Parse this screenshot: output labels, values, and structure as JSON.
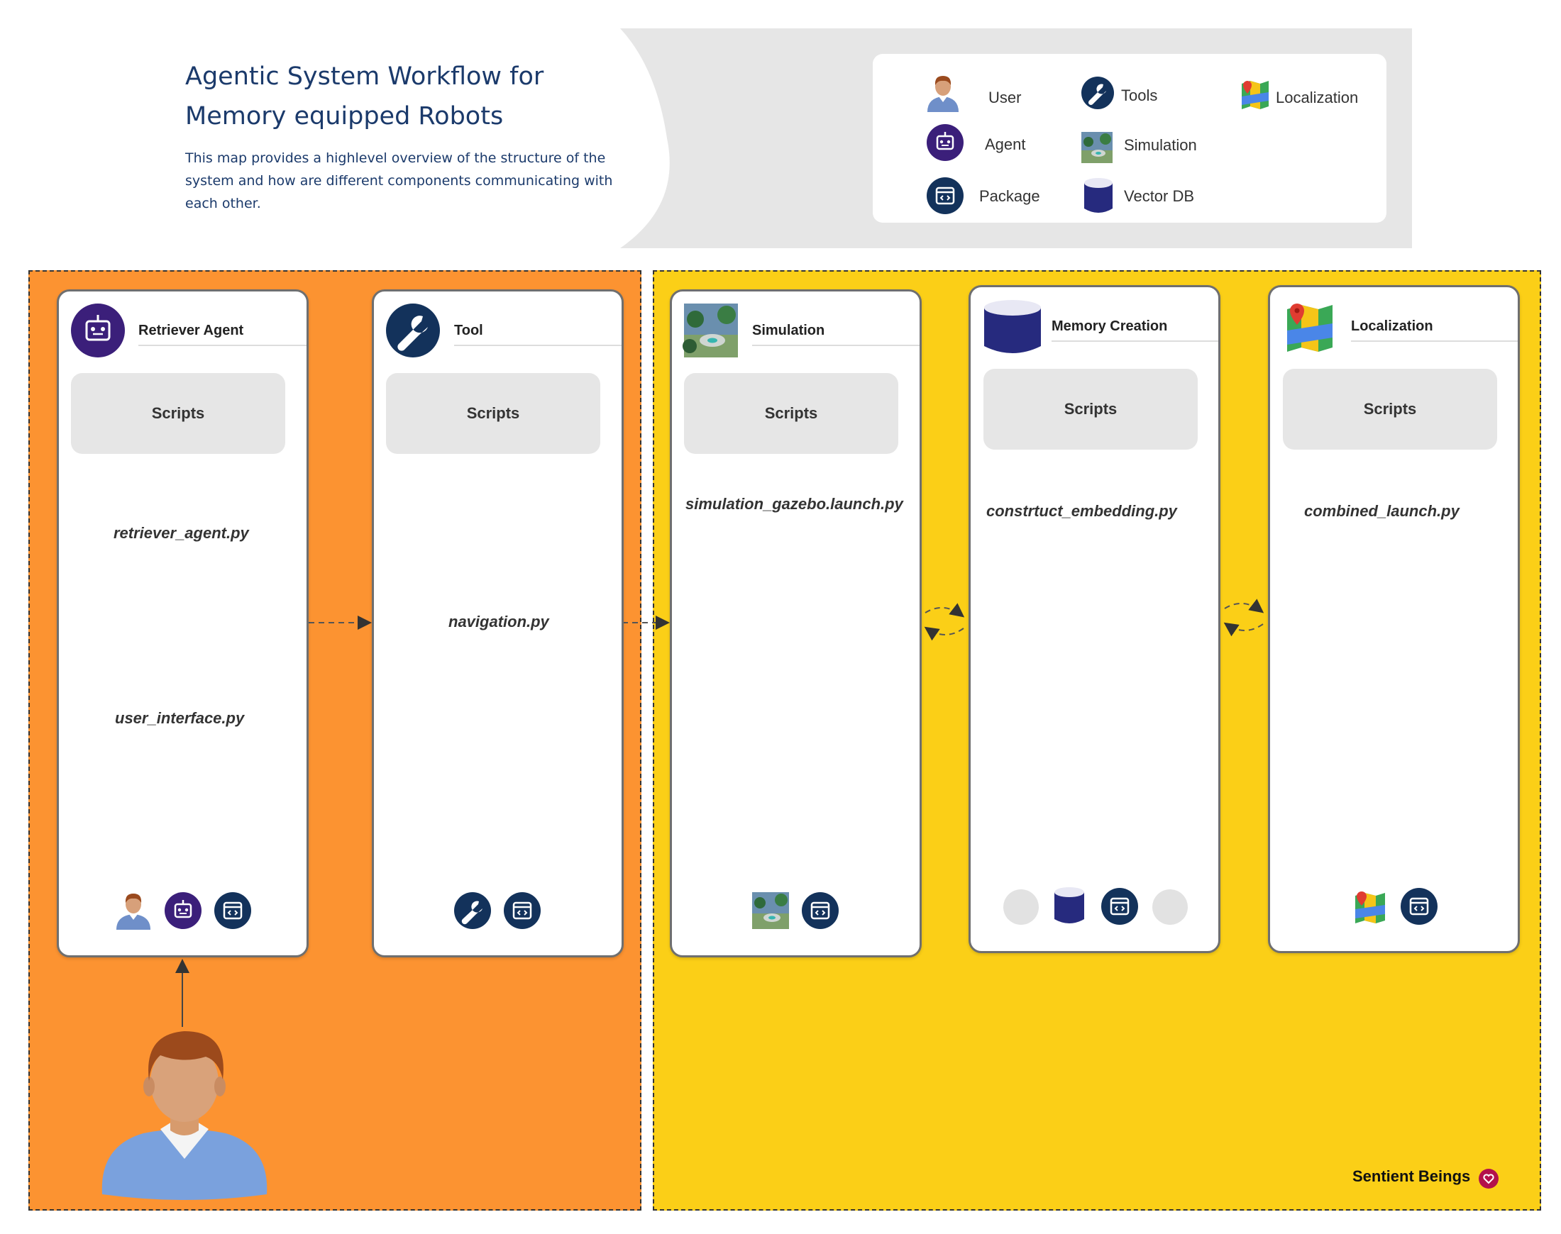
{
  "header": {
    "title": "Agentic System Workflow for Memory equipped Robots",
    "description": "This map provides a highlevel  overview of the structure of the system and how are different components communicating with each other."
  },
  "legend": {
    "user": "User",
    "agent": "Agent",
    "package": "Package",
    "tools": "Tools",
    "simulation": "Simulation",
    "vector_db": "Vector DB",
    "localization": "Localization"
  },
  "cards": {
    "retriever": {
      "title": "Retriever Agent",
      "scripts": "Scripts",
      "files": [
        "retriever_agent.py",
        "user_interface.py"
      ]
    },
    "tool": {
      "title": "Tool",
      "scripts": "Scripts",
      "files": [
        "navigation.py"
      ]
    },
    "simulation": {
      "title": "Simulation",
      "scripts": "Scripts",
      "files": [
        "simulation_gazebo.launch.py"
      ]
    },
    "memory": {
      "title": "Memory Creation",
      "scripts": "Scripts",
      "files": [
        "constrtuct_embedding.py"
      ]
    },
    "localization": {
      "title": "Localization",
      "scripts": "Scripts",
      "files": [
        "combined_launch.py"
      ]
    }
  },
  "footer": {
    "brand": "Sentient Beings"
  },
  "colors": {
    "orange_zone": "#fc9331",
    "yellow_zone": "#fbcf17",
    "navy": "#13325b",
    "agent_purple": "#3b1f7a",
    "vector_db": "#262a7e",
    "header_gray": "#e6e6e6",
    "brand_heart": "#b3114b"
  }
}
